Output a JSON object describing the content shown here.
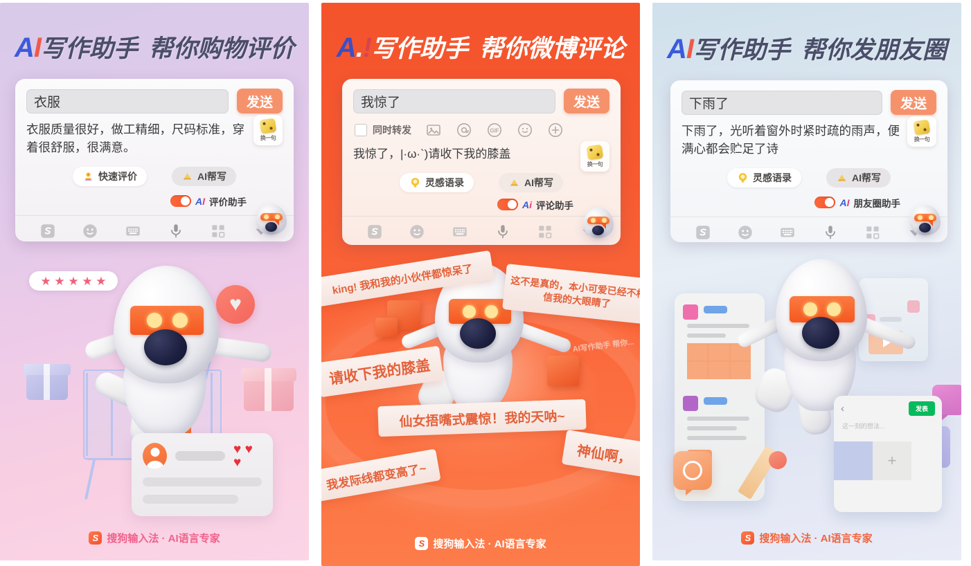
{
  "meta": {
    "panel_count": 3
  },
  "brand": {
    "logo_letter": "S",
    "text": "搜狗输入法 · AI语言专家"
  },
  "panels": [
    {
      "id": "shopping-review",
      "heading": {
        "ai": "AI",
        "title": "写作助手",
        "subtitle": "帮你购物评价"
      },
      "keyboard": {
        "input_value": "衣服",
        "send_label": "发送",
        "suggestion": "衣服质量很好，做工精细，尺码标准，穿着很舒服，很满意。",
        "dice_label": "换一句",
        "pills": [
          {
            "icon": "flower-icon",
            "label": "快速评价"
          },
          {
            "icon": "pen-icon",
            "label": "AI帮写"
          }
        ],
        "toggle": {
          "on": true,
          "ai": "AI",
          "label": "评价助手"
        },
        "bar_icons": [
          "sogou-logo-icon",
          "emoji-icon",
          "keyboard-icon",
          "microphone-icon",
          "apps-grid-icon",
          "chevron-down-icon"
        ]
      },
      "illustration": {
        "stars": "★ ★ ★ ★ ★",
        "review_card_hearts": "♥ ♥ ♥"
      }
    },
    {
      "id": "weibo-comment",
      "heading": {
        "ai": "AI",
        "title": "写作助手",
        "subtitle": "帮你微博评论"
      },
      "keyboard": {
        "input_value": "我惊了",
        "send_label": "发送",
        "weibo_toolbar": {
          "checkbox_label": "同时转发",
          "icons": [
            "image-icon",
            "mention-at-icon",
            "gif-icon",
            "emoji-icon",
            "plus-circle-icon"
          ]
        },
        "suggestion": "我惊了，|·ω·`)请收下我的膝盖",
        "dice_label": "换一句",
        "pills": [
          {
            "icon": "lightbulb-icon",
            "label": "灵感语录"
          },
          {
            "icon": "pen-icon",
            "label": "AI帮写"
          }
        ],
        "toggle": {
          "on": true,
          "ai": "Ai",
          "label": "评论助手"
        },
        "bar_icons": [
          "sogou-logo-icon",
          "emoji-icon",
          "keyboard-icon",
          "microphone-icon",
          "apps-grid-icon",
          "chevron-down-icon"
        ]
      },
      "illustration": {
        "banners": [
          "king! 我和我的小伙伴都惊呆了",
          "这不是真的，本小可爱已经不相信我的大眼睛了",
          "请收下我的膝盖",
          "仙女捂嘴式震惊！我的天呐~",
          "我发际线都变高了~",
          "神仙啊，",
          "AI写作助手  帮你..."
        ]
      }
    },
    {
      "id": "moments-post",
      "heading": {
        "ai": "AI",
        "title": "写作助手",
        "subtitle": "帮你发朋友圈"
      },
      "keyboard": {
        "input_value": "下雨了",
        "send_label": "发送",
        "suggestion": "下雨了，光听着窗外时紧时疏的雨声，便满心都会贮足了诗",
        "dice_label": "换一句",
        "pills": [
          {
            "icon": "lightbulb-icon",
            "label": "灵感语录"
          },
          {
            "icon": "pen-icon",
            "label": "AI帮写"
          }
        ],
        "toggle": {
          "on": true,
          "ai": "AI",
          "label": "朋友圈助手"
        },
        "bar_icons": [
          "sogou-logo-icon",
          "emoji-icon",
          "keyboard-icon",
          "microphone-icon",
          "apps-grid-icon",
          "chevron-down-icon"
        ]
      },
      "illustration": {
        "moment_card": {
          "back_icon": "chevron-left-icon",
          "send_label": "发表",
          "placeholder": "这一刻的想法...",
          "add_icon": "plus-icon"
        }
      }
    }
  ],
  "colors": {
    "orange_accent": "#f4532c",
    "send_button": "#f5926c",
    "toggle_on": "#f8512a",
    "wechat_green": "#09ba5c",
    "heading_dark": "#4a4e69",
    "brand_pink": "#f0618b",
    "brand_orange": "#f2643f"
  }
}
